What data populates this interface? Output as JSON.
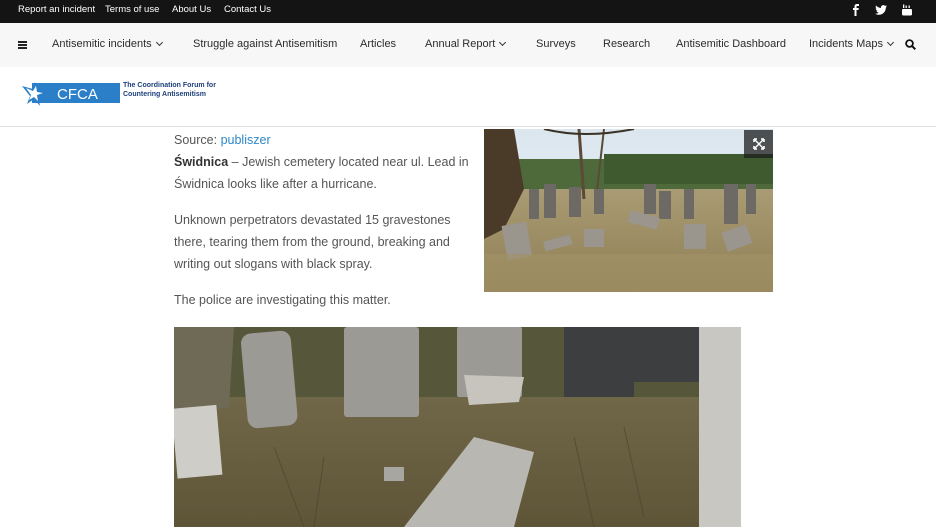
{
  "topbar": {
    "links": [
      "Report an incident",
      "Terms of use",
      "About Us",
      "Contact Us"
    ],
    "social": [
      "facebook-icon",
      "twitter-icon",
      "youtube-icon"
    ]
  },
  "nav": {
    "items": [
      {
        "label": "Antisemitic incidents",
        "dropdown": true
      },
      {
        "label": "Struggle against Antisemitism",
        "dropdown": false
      },
      {
        "label": "Articles",
        "dropdown": false
      },
      {
        "label": "Annual Report",
        "dropdown": true
      },
      {
        "label": "Surveys",
        "dropdown": false
      },
      {
        "label": "Research",
        "dropdown": false
      },
      {
        "label": "Antisemitic Dashboard",
        "dropdown": false
      },
      {
        "label": "Incidents Maps",
        "dropdown": true
      }
    ]
  },
  "header": {
    "logo_acronym": "CFCA",
    "logo_line1": "The Coordination Forum for",
    "logo_line2": "Countering Antisemitism"
  },
  "article": {
    "source_label": "Source:",
    "source_link": "publiszer",
    "city_bold": "Świdnica",
    "para1": " – Jewish cemetery located near ul. Lead in Świdnica looks like after a hurricane.",
    "para2": "Unknown perpetrators devastated 15 gravestones there, tearing them from the ground, breaking and writing out slogans with black spray.",
    "para3": "The police are investigating this matter."
  },
  "colors": {
    "topbar_bg": "#141414",
    "nav_bg": "#f7f7f7",
    "link": "#2e88c9",
    "brand": "#2b7fc9"
  }
}
